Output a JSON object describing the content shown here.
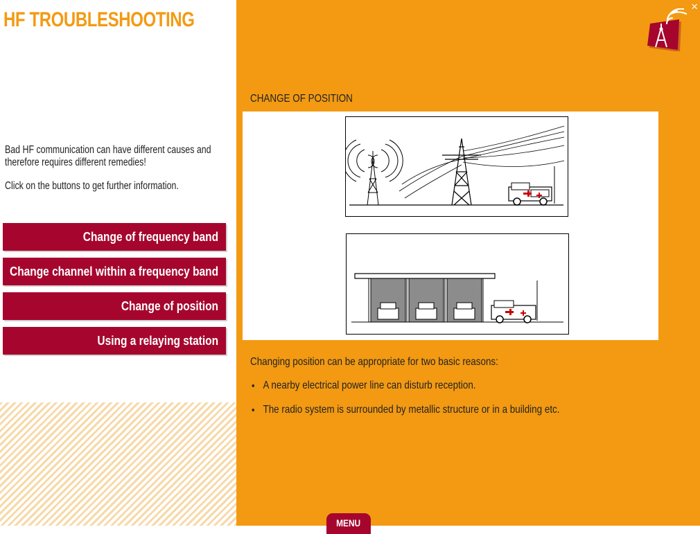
{
  "app": {
    "title": "HF TROUBLESHOOTING",
    "close_label": "×"
  },
  "intro": {
    "paragraph1": "Bad HF communication can have different causes and therefore requires different remedies!",
    "paragraph2": "Click on the buttons to get further information."
  },
  "nav": {
    "items": [
      {
        "label": "Change of frequency band"
      },
      {
        "label": "Change channel within a frequency band"
      },
      {
        "label": "Change of position"
      },
      {
        "label": "Using a relaying station"
      }
    ]
  },
  "content": {
    "section_title": "CHANGE OF POSITION",
    "description": "Changing position can be appropriate for two basic reasons:",
    "bullets": [
      "A nearby electrical power line can disturb reception.",
      "The radio system is surrounded by metallic structure or in a building etc."
    ]
  },
  "footer": {
    "menu_label": "MENU"
  },
  "colors": {
    "accent": "#f39a12",
    "brand_red": "#a6062e",
    "hatch": "#f6d9a8"
  },
  "icons": {
    "logo": "radio-antenna-logo-icon",
    "close": "close-icon"
  }
}
